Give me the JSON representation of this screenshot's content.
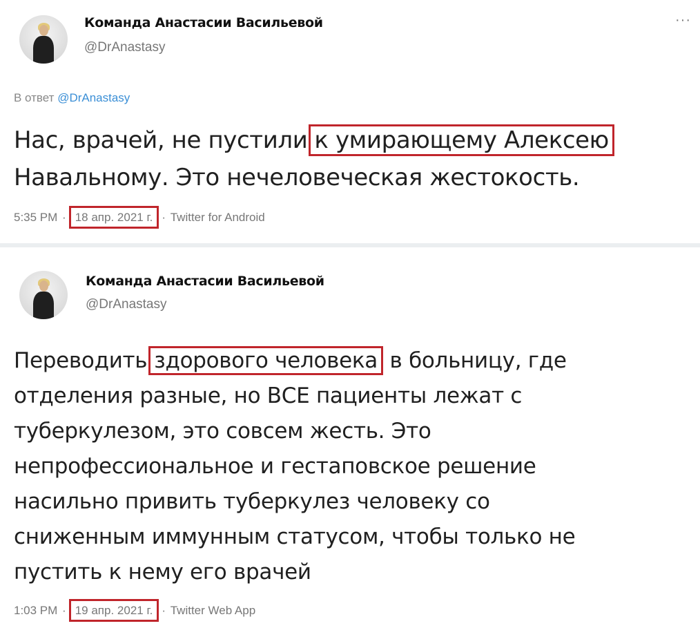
{
  "tweets": [
    {
      "author_name": "Команда Анастасии Васильевой",
      "handle": "@DrAnastasy",
      "more_label": "···",
      "reply_prefix": "В ответ",
      "reply_to": "@DrAnastasy",
      "text_before": "Нас, врачей, не пустили",
      "text_highlight": "к умирающему Алексею",
      "text_after": "Навальному. Это нечеловеческая жестокость.",
      "time": "5:35 PM",
      "date": "18 апр. 2021 г.",
      "source": "Twitter for Android"
    },
    {
      "author_name": "Команда Анастасии Васильевой",
      "handle": "@DrAnastasy",
      "text_before": "Переводить",
      "text_highlight": "здорового человека",
      "text_after": "в больницу, где",
      "text_lines": [
        "отделения разные, но ВСЕ пациенты лежат с",
        "туберкулезом, это совсем жесть. Это",
        "непрофессиональное и гестаповское решение",
        "насильно привить туберкулез человеку со",
        "сниженным иммунным статусом, чтобы только не",
        "пустить к нему его врачей"
      ],
      "time": "1:03 PM",
      "date": "19 апр. 2021 г.",
      "source": "Twitter Web App"
    }
  ],
  "colors": {
    "highlight_border": "#c0252b",
    "link": "#3b8fd6",
    "divider": "#ebeef0"
  }
}
